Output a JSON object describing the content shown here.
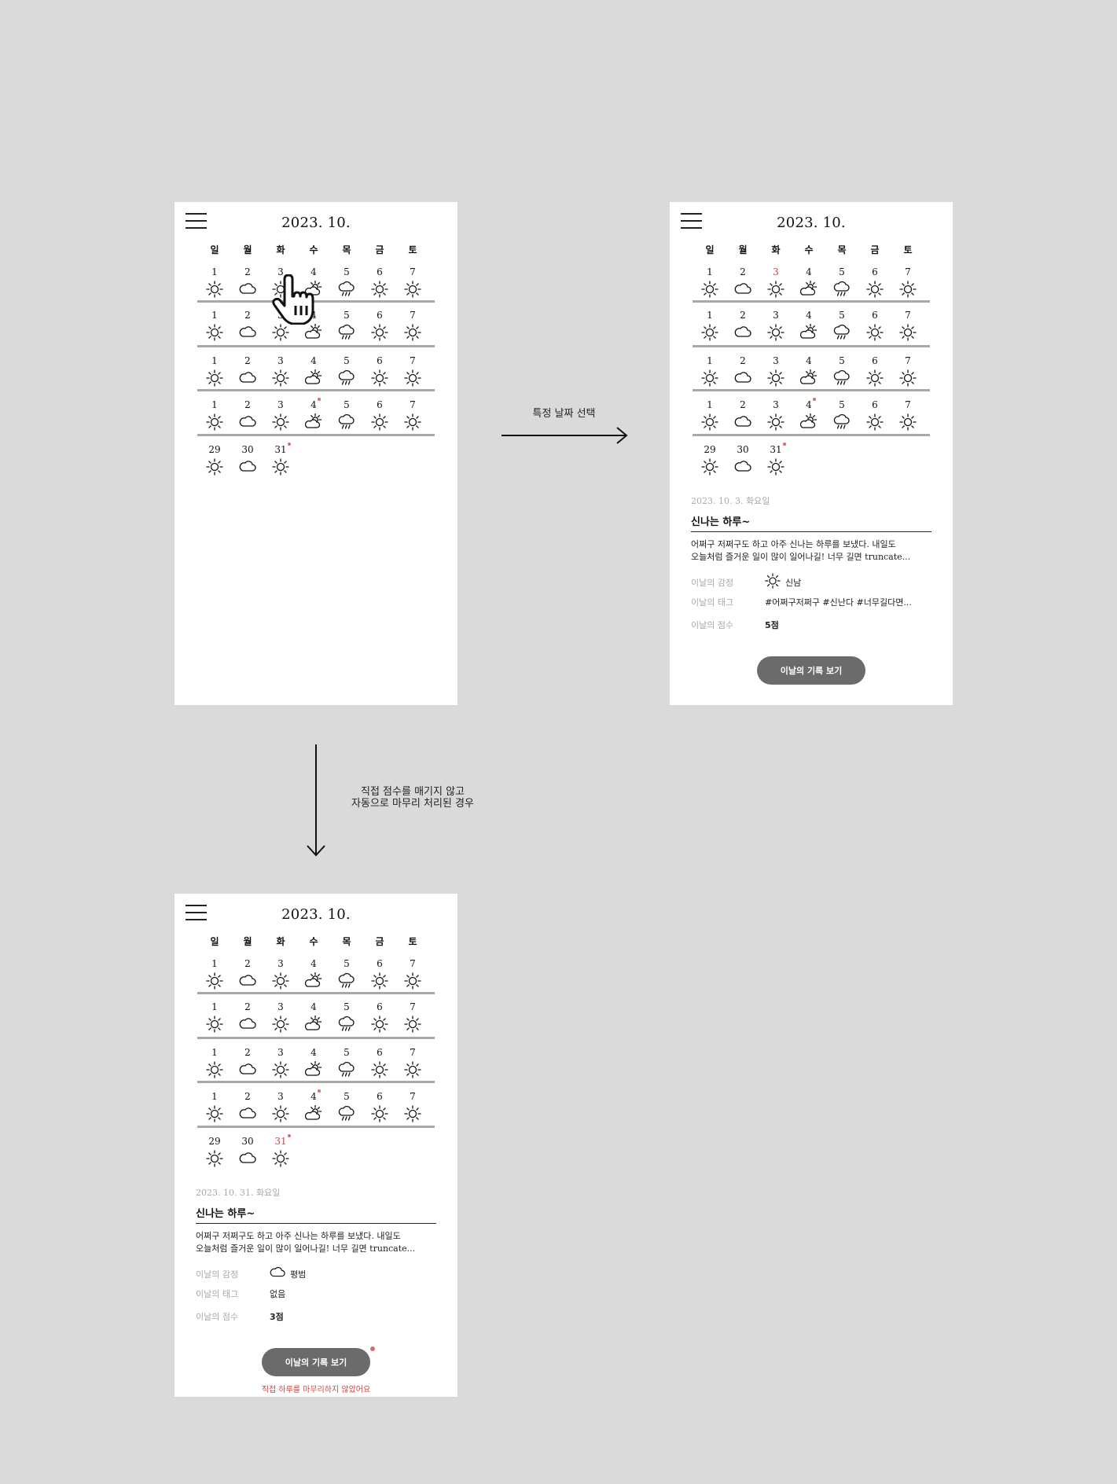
{
  "month_title": "2023. 10.",
  "weekdays": [
    "일",
    "월",
    "화",
    "수",
    "목",
    "금",
    "토"
  ],
  "weeks": [
    {
      "days": [
        {
          "label": "1",
          "icon": "sun-icon"
        },
        {
          "label": "2",
          "icon": "cloud-icon"
        },
        {
          "label": "3",
          "icon": "sun-icon"
        },
        {
          "label": "4",
          "icon": "partly-cloudy-icon"
        },
        {
          "label": "5",
          "icon": "rain-cloud-icon"
        },
        {
          "label": "6",
          "icon": "sun-icon"
        },
        {
          "label": "7",
          "icon": "sun-icon"
        }
      ]
    },
    {
      "days": [
        {
          "label": "1",
          "icon": "sun-icon"
        },
        {
          "label": "2",
          "icon": "cloud-icon"
        },
        {
          "label": "3",
          "icon": "sun-icon"
        },
        {
          "label": "4",
          "icon": "partly-cloudy-icon"
        },
        {
          "label": "5",
          "icon": "rain-cloud-icon"
        },
        {
          "label": "6",
          "icon": "sun-icon"
        },
        {
          "label": "7",
          "icon": "sun-icon"
        }
      ]
    },
    {
      "days": [
        {
          "label": "1",
          "icon": "sun-icon"
        },
        {
          "label": "2",
          "icon": "cloud-icon"
        },
        {
          "label": "3",
          "icon": "sun-icon"
        },
        {
          "label": "4",
          "icon": "partly-cloudy-icon"
        },
        {
          "label": "5",
          "icon": "rain-cloud-icon"
        },
        {
          "label": "6",
          "icon": "sun-icon"
        },
        {
          "label": "7",
          "icon": "sun-icon"
        }
      ]
    },
    {
      "days": [
        {
          "label": "1",
          "icon": "sun-icon"
        },
        {
          "label": "2",
          "icon": "cloud-icon"
        },
        {
          "label": "3",
          "icon": "sun-icon"
        },
        {
          "label": "4",
          "icon": "partly-cloudy-icon",
          "dot": true
        },
        {
          "label": "5",
          "icon": "rain-cloud-icon"
        },
        {
          "label": "6",
          "icon": "sun-icon"
        },
        {
          "label": "7",
          "icon": "sun-icon"
        }
      ]
    },
    {
      "days": [
        {
          "label": "29",
          "icon": "sun-icon"
        },
        {
          "label": "30",
          "icon": "cloud-icon"
        },
        {
          "label": "31",
          "icon": "sun-icon",
          "dot": true
        }
      ]
    }
  ],
  "screens": {
    "main": {
      "selected": null
    },
    "selected": {
      "selected": [
        0,
        2
      ],
      "detail": {
        "date": "2023. 10. 3. 화요일",
        "title": "신나는 하루~",
        "body_line1": "어쩌구 저쩌구도 하고 아주 신나는 하루를 보냈다. 내일도",
        "body_line2": "오늘처럼 즐거운 일이 많이 일어나길! 너무 길면 truncate...",
        "emotion_label": "이날의 감정",
        "emotion_icon": "sun-icon",
        "emotion_value": "신남",
        "tag_label": "이날의 태그",
        "tag_value": "#어쩌구저쩌구 #신난다 #너무길다면...",
        "score_label": "이날의 점수",
        "score_value": "5점",
        "button_label": "이날의 기록 보기"
      }
    },
    "auto": {
      "selected": [
        4,
        2
      ],
      "detail": {
        "date": "2023. 10. 31. 화요일",
        "title": "신나는 하루~",
        "body_line1": "어쩌구 저쩌구도 하고 아주 신나는 하루를 보냈다. 내일도",
        "body_line2": "오늘처럼 즐거운 일이 많이 일어나길! 너무 길면 truncate...",
        "emotion_label": "이날의 감정",
        "emotion_icon": "cloud-icon",
        "emotion_value": "평범",
        "tag_label": "이날의 태그",
        "tag_value": "없음",
        "score_label": "이날의 점수",
        "score_value": "3점",
        "button_label": "이날의 기록 보기",
        "warning": "직접 하루를 마무리하지 않았어요"
      }
    }
  },
  "annotations": {
    "select_date": "특정 날짜 선택",
    "auto_line1": "직접 점수를 매기지 않고",
    "auto_line2": "자동으로 마무리 처리된 경우"
  },
  "colors": {
    "selected_day": "#d0453e",
    "dot": "#e06a6a",
    "button": "#6b6b6b",
    "line": "#a8a8a8"
  }
}
